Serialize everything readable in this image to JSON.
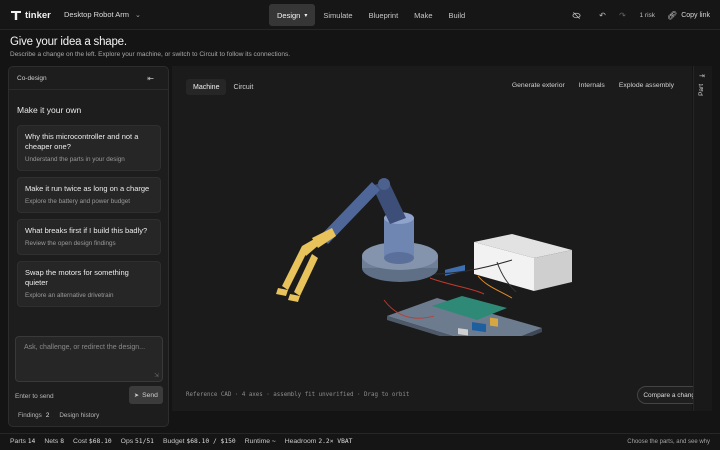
{
  "app": {
    "name": "tinker",
    "project": "Desktop Robot Arm"
  },
  "nav": {
    "tabs": [
      {
        "label": "Design",
        "active": true
      },
      {
        "label": "Simulate"
      },
      {
        "label": "Blueprint"
      },
      {
        "label": "Make"
      },
      {
        "label": "Build"
      }
    ]
  },
  "toolbar": {
    "risk_label": "1 risk",
    "copy_link": "Copy link"
  },
  "header": {
    "title": "Give your idea a shape.",
    "subtitle": "Describe a change on the left. Explore your machine, or switch to Circuit to follow its connections."
  },
  "codesign": {
    "panel_title": "Co-design",
    "section_title": "Make it your own",
    "cards": [
      {
        "title": "Why this microcontroller and not a cheaper one?",
        "subtitle": "Understand the parts in your design"
      },
      {
        "title": "Make it run twice as long on a charge",
        "subtitle": "Explore the battery and power budget"
      },
      {
        "title": "What breaks first if I build this badly?",
        "subtitle": "Review the open design findings"
      },
      {
        "title": "Swap the motors for something quieter",
        "subtitle": "Explore an alternative drivetrain"
      }
    ],
    "input_placeholder": "Ask, challenge, or redirect the design...",
    "enter_hint": "Enter to send",
    "send_label": "Send",
    "footer": {
      "findings_label": "Findings",
      "findings_count": "2",
      "history_label": "Design history"
    }
  },
  "viewport": {
    "tabs": [
      {
        "label": "Machine",
        "active": true
      },
      {
        "label": "Circuit"
      }
    ],
    "actions": [
      "Generate exterior",
      "Internals",
      "Explode assembly"
    ],
    "reference_line": "Reference CAD · 4 axes · assembly fit unverified · Drag to orbit",
    "compare_label": "Compare a change"
  },
  "rail": {
    "label": "Part"
  },
  "status": {
    "items": [
      {
        "label": "Parts",
        "value": "14"
      },
      {
        "label": "Nets",
        "value": "8"
      },
      {
        "label": "Cost",
        "value": "$68.10"
      },
      {
        "label": "Ops",
        "value": "51/51"
      },
      {
        "label": "Budget",
        "value": "$68.10 / $150"
      },
      {
        "label": "Runtime",
        "value": "~"
      },
      {
        "label": "Headroom",
        "value": "2.2× VBAT"
      }
    ],
    "hint": "Choose the parts, and see why"
  },
  "colors": {
    "accent_yellow": "#e8c25a",
    "arm_blue": "#6f86b3",
    "board_teal": "#2e8a76",
    "base_slate": "#6a7a8e"
  }
}
